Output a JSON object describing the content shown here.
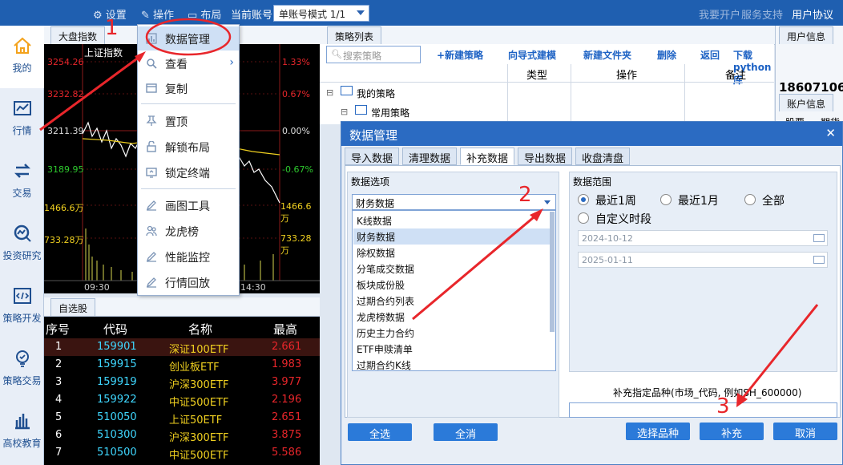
{
  "topbar": {
    "settings": "设置",
    "operation": "操作",
    "layout": "布局",
    "current_account": "当前账号",
    "mode": "单账号模式 1/1",
    "open_account": "我要开户",
    "service": "服务支持",
    "user_agreement": "用户协议"
  },
  "sidebar": [
    {
      "label": "我的",
      "icon": "home-icon"
    },
    {
      "label": "行情",
      "icon": "chart-line-icon"
    },
    {
      "label": "交易",
      "icon": "exchange-icon"
    },
    {
      "label": "投资研究",
      "icon": "research-icon"
    },
    {
      "label": "策略开发",
      "icon": "code-icon"
    },
    {
      "label": "策略交易",
      "icon": "bulb-icon"
    },
    {
      "label": "高校教育",
      "icon": "building-icon"
    }
  ],
  "index_panel": {
    "tab": "大盘指数",
    "name": "上证指数",
    "left_scale": [
      "3254.26",
      "3232.82",
      "3211.39",
      "3189.95",
      "1466.6万",
      "733.28万"
    ],
    "right_scale": [
      "1.33%",
      "0.67%",
      "0.00%",
      "-0.67%",
      "1466.6万",
      "733.28万"
    ],
    "times": [
      "09:30",
      "14:30"
    ]
  },
  "watchlist": {
    "tab": "自选股",
    "headers": [
      "序号",
      "代码",
      "名称",
      "最高"
    ],
    "rows": [
      {
        "no": "1",
        "code": "159901",
        "name": "深证100ETF",
        "high": "2.661"
      },
      {
        "no": "2",
        "code": "159915",
        "name": "创业板ETF",
        "high": "1.983"
      },
      {
        "no": "3",
        "code": "159919",
        "name": "沪深300ETF",
        "high": "3.977"
      },
      {
        "no": "4",
        "code": "159922",
        "name": "中证500ETF",
        "high": "2.196"
      },
      {
        "no": "5",
        "code": "510050",
        "name": "上证50ETF",
        "high": "2.651"
      },
      {
        "no": "6",
        "code": "510300",
        "name": "沪深300ETF",
        "high": "3.875"
      },
      {
        "no": "7",
        "code": "510500",
        "name": "中证500ETF",
        "high": "5.586"
      }
    ]
  },
  "menu": [
    {
      "label": "数据管理",
      "icon": "bar-chart-icon"
    },
    {
      "label": "查看",
      "icon": "search-icon"
    },
    {
      "label": "复制",
      "icon": "copy-icon"
    },
    {
      "label": "置顶",
      "icon": "pin-icon"
    },
    {
      "label": "解锁布局",
      "icon": "unlock-icon"
    },
    {
      "label": "锁定终端",
      "icon": "lock-icon"
    },
    {
      "label": "画图工具",
      "icon": "pencil-icon"
    },
    {
      "label": "龙虎榜",
      "icon": "group-icon"
    },
    {
      "label": "性能监控",
      "icon": "pencil-icon"
    },
    {
      "label": "行情回放",
      "icon": "pencil-icon"
    }
  ],
  "strategy": {
    "tab": "策略列表",
    "search_placeholder": "搜索策略",
    "actions": [
      "+新建策略",
      "向导式建模",
      "新建文件夹",
      "删除",
      "返回",
      "下载python库"
    ],
    "columns": [
      "类型",
      "操作",
      "备注"
    ],
    "tree": [
      "我的策略",
      "常用策略"
    ]
  },
  "user_panel": {
    "tab": "用户信息",
    "phone": "18607106",
    "account_tab": "账户信息",
    "cols": [
      "股票",
      "期货"
    ]
  },
  "dialog": {
    "title": "数据管理",
    "tabs": [
      "导入数据",
      "清理数据",
      "补充数据",
      "导出数据",
      "收盘清盘"
    ],
    "options_title": "数据选项",
    "selected": "财务数据",
    "options": [
      "K线数据",
      "财务数据",
      "除权数据",
      "分笔成交数据",
      "板块成份股",
      "过期合约列表",
      "龙虎榜数据",
      "历史主力合约",
      "ETF申赎清单",
      "过期合约K线"
    ],
    "range_title": "数据范围",
    "ranges": [
      "最近1周",
      "最近1月",
      "全部",
      "自定义时段"
    ],
    "date_start": "2024-10-12",
    "date_end": "2025-01-11",
    "specify_label": "补充指定品种(市场_代码, 例如SH_600000)",
    "buttons": [
      "全选",
      "全消",
      "选择品种",
      "补充",
      "取消"
    ]
  },
  "annotations": [
    "1",
    "2",
    "3"
  ],
  "colors": {
    "topbar": "#1f5fb0",
    "accent": "#2b7ad9",
    "annotation": "#e8262b"
  }
}
